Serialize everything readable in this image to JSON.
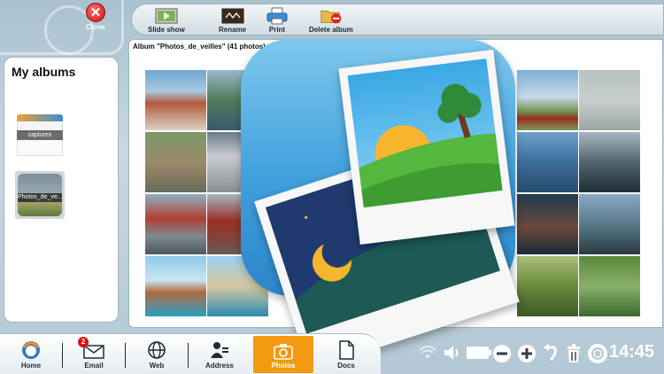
{
  "window": {
    "close_label": "Close"
  },
  "toolbar": {
    "slideshow_label": "Slide show",
    "rename_label": "Rename",
    "print_label": "Print",
    "delete_label": "Delete album"
  },
  "sidebar": {
    "title": "My albums",
    "albums": [
      {
        "label": "captures"
      },
      {
        "label": "Photos_de_ve..."
      }
    ]
  },
  "main": {
    "album_header": "Album \"Photos_de_veilles\" (41 photos)"
  },
  "taskbar": {
    "items": [
      {
        "label": "Home"
      },
      {
        "label": "Email",
        "badge": "2"
      },
      {
        "label": "Web"
      },
      {
        "label": "Address"
      },
      {
        "label": "Photos"
      },
      {
        "label": "Docs"
      }
    ]
  },
  "status": {
    "time": "14:45"
  },
  "colors": {
    "accent": "#f39a12",
    "close": "#c81414"
  }
}
